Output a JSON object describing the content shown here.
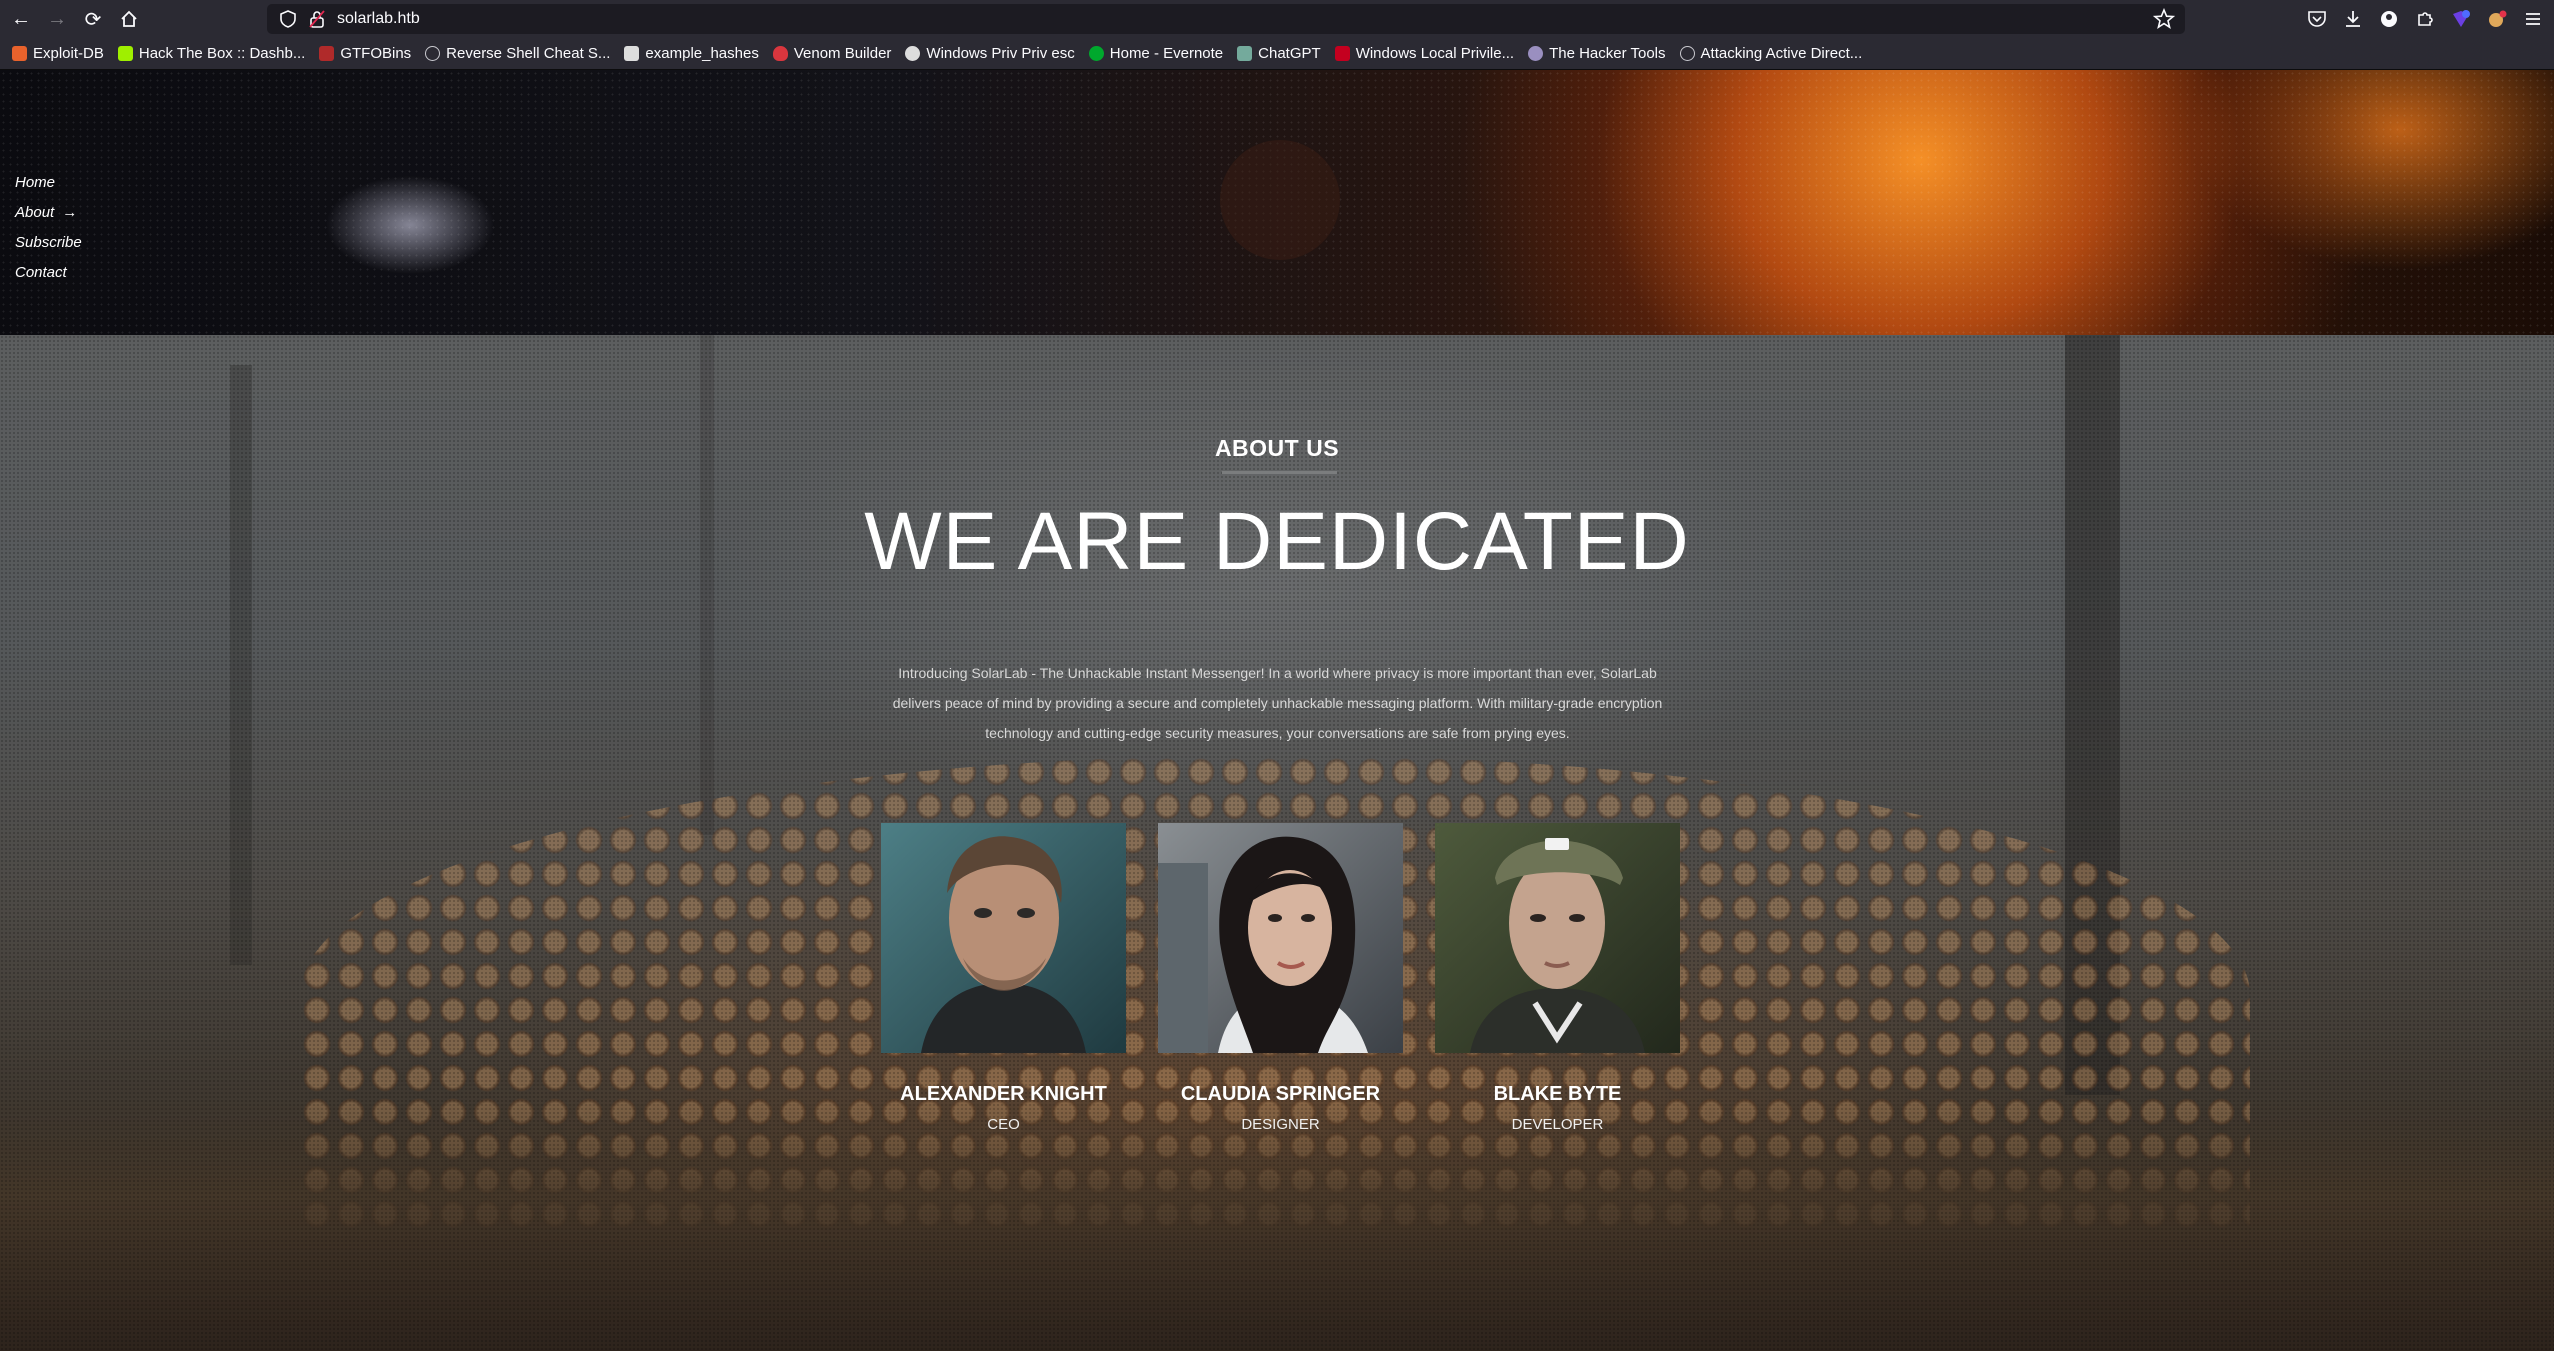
{
  "browser": {
    "url": "solarlab.htb",
    "bookmarks": [
      {
        "label": "Exploit-DB",
        "color": "#e8622c"
      },
      {
        "label": "Hack The Box :: Dashb...",
        "color": "#9fef00"
      },
      {
        "label": "GTFOBins",
        "color": "#b02a2a"
      },
      {
        "label": "Reverse Shell Cheat S...",
        "color": "#9aa0a6"
      },
      {
        "label": "example_hashes",
        "color": "#dddddd"
      },
      {
        "label": "Venom Builder",
        "color": "#d9363e"
      },
      {
        "label": "Windows Priv Priv esc",
        "color": "#dddddd"
      },
      {
        "label": "Home - Evernote",
        "color": "#00a82d"
      },
      {
        "label": "ChatGPT",
        "color": "#74aa9c"
      },
      {
        "label": "Windows Local Privile...",
        "color": "#c4001f"
      },
      {
        "label": "The Hacker Tools",
        "color": "#9a8fc0"
      },
      {
        "label": "Attacking Active Direct...",
        "color": "#9aa0a6"
      }
    ]
  },
  "nav": {
    "items": [
      {
        "label": "Home"
      },
      {
        "label": "About",
        "arrow": "→"
      },
      {
        "label": "Subscribe"
      },
      {
        "label": "Contact"
      }
    ]
  },
  "about": {
    "section_label": "ABOUT US",
    "headline": "WE ARE DEDICATED",
    "intro": "Introducing SolarLab - The Unhackable Instant Messenger! In a world where privacy is more important than ever, SolarLab delivers peace of mind by providing a secure and completely unhackable messaging platform. With military-grade encryption technology and cutting-edge security measures, your conversations are safe from prying eyes."
  },
  "team": [
    {
      "name": "ALEXANDER KNIGHT",
      "role": "CEO"
    },
    {
      "name": "CLAUDIA SPRINGER",
      "role": "DESIGNER"
    },
    {
      "name": "BLAKE BYTE",
      "role": "DEVELOPER"
    }
  ]
}
